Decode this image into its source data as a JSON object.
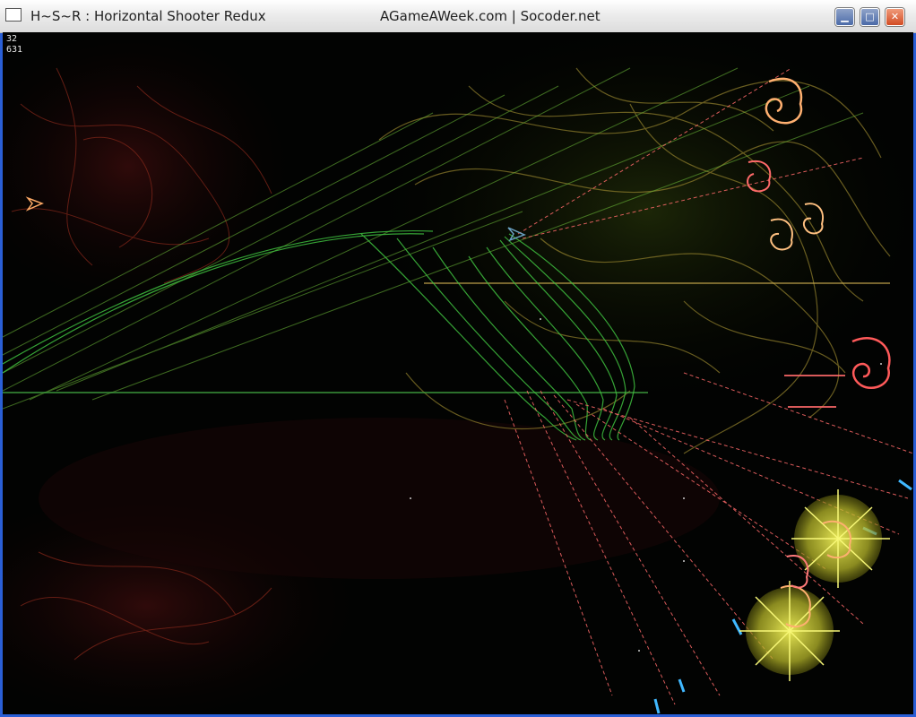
{
  "window": {
    "title": "H~S~R : Horizontal Shooter Redux",
    "subtitle": "AGameAWeek.com | Socoder.net",
    "minimize_glyph": "▁",
    "maximize_glyph": "□",
    "close_glyph": "✕"
  },
  "hud": {
    "line1": "32",
    "line2": "631"
  },
  "icons": {
    "player_ship": "player-ship-icon",
    "enemy": "enemy-swirl-icon",
    "explosion": "explosion-glow"
  },
  "colors": {
    "title_bar": "#ececec",
    "window_border": "#2a5fd6",
    "green_trail": "#3fbf3f",
    "red_laser": "#ff6a6a",
    "yellow_glow": "#e6e640",
    "enemy_orange": "#ffb070",
    "enemy_red": "#ff5a5a",
    "player_blue": "#40b8ff"
  }
}
